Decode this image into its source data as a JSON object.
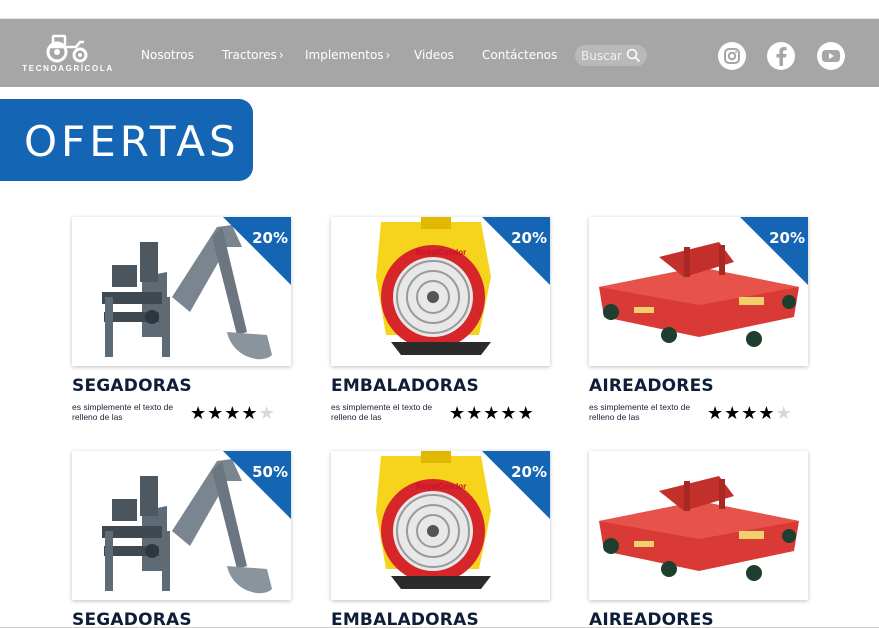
{
  "brand": {
    "logo_text": "TECNOAGRÍCOLA",
    "nav_bg": "#a6a6a6",
    "accent": "#1565b5"
  },
  "nav": {
    "items": [
      {
        "label": "Nosotros"
      },
      {
        "label": "Tractores",
        "chevron": "›"
      },
      {
        "label": "Implementos",
        "chevron": "›"
      },
      {
        "label": "Videos"
      },
      {
        "label": "Contáctenos"
      }
    ],
    "search_placeholder": "Buscar"
  },
  "social": [
    "instagram-icon",
    "facebook-icon",
    "youtube-icon"
  ],
  "section": {
    "title": "OFERTAS"
  },
  "products": [
    {
      "title": "SEGADORAS",
      "desc": "es simplemente el texto de relleno de las",
      "discount": "20%",
      "rating": 4,
      "image": "backhoe"
    },
    {
      "title": "EMBALADORAS",
      "desc": "es simplemente el texto de relleno de las",
      "discount": "20%",
      "rating": 5,
      "image": "sprayer"
    },
    {
      "title": "AIREADORES",
      "desc": "es simplemente el texto de relleno de las",
      "discount": "20%",
      "rating": 4,
      "image": "mower"
    },
    {
      "title": "SEGADORAS",
      "discount": "50%",
      "image": "backhoe"
    },
    {
      "title": "EMBALADORAS",
      "discount": "20%",
      "image": "sprayer"
    },
    {
      "title": "AIREADORES",
      "discount": "",
      "image": "mower"
    }
  ]
}
